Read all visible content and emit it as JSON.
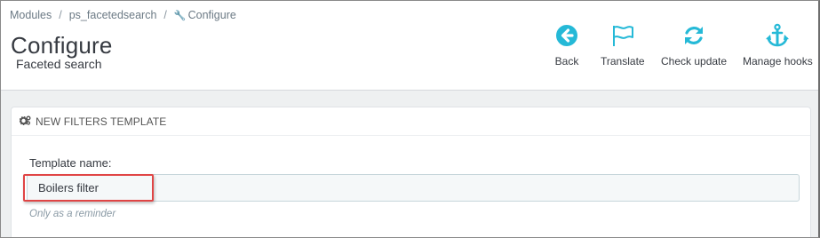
{
  "breadcrumb": {
    "items": [
      "Modules",
      "ps_facetedsearch",
      "Configure"
    ],
    "separator": "/"
  },
  "header": {
    "title": "Configure",
    "subtitle": "Faceted search"
  },
  "toolbar": {
    "buttons": [
      {
        "label": "Back",
        "icon": "arrow-left-circle-icon"
      },
      {
        "label": "Translate",
        "icon": "flag-icon"
      },
      {
        "label": "Check update",
        "icon": "refresh-icon"
      },
      {
        "label": "Manage hooks",
        "icon": "anchor-icon"
      }
    ],
    "icon_color": "#25b9d7"
  },
  "panel": {
    "heading": "NEW FILTERS TEMPLATE",
    "field_label": "Template name:",
    "field_value": "Boilers filter",
    "help_text": "Only as a reminder"
  },
  "colors": {
    "accent": "#25b9d7",
    "highlight": "#e04545",
    "background": "#eef0f1"
  }
}
